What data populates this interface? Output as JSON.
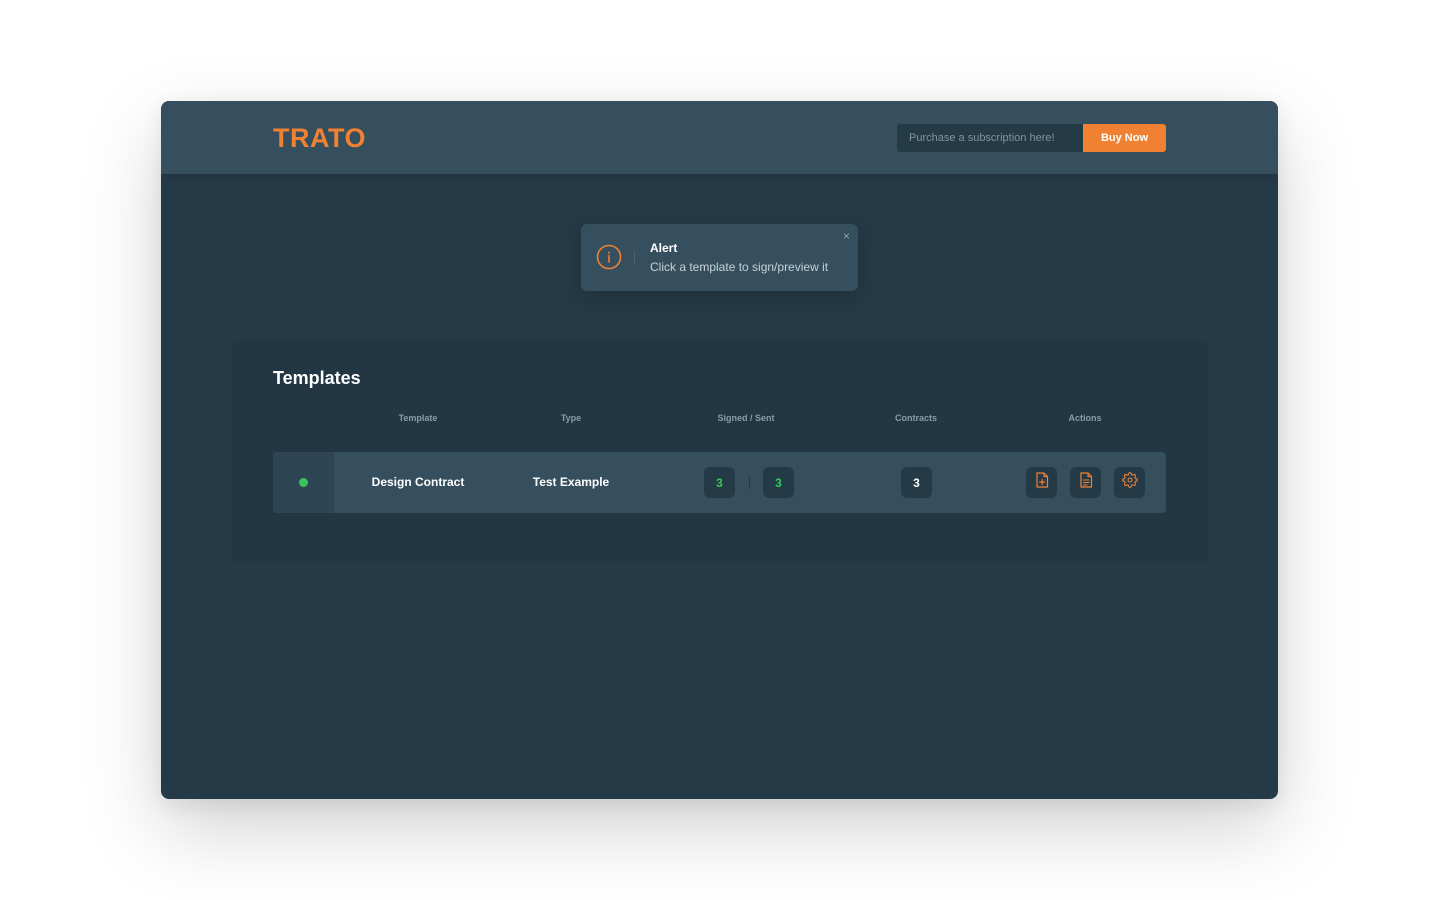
{
  "header": {
    "logo": "TRATO",
    "subscription_placeholder": "Purchase a subscription here!",
    "buy_label": "Buy Now"
  },
  "alert": {
    "title": "Alert",
    "message": "Click a template to sign/preview it",
    "close_glyph": "×",
    "icon": "info-icon"
  },
  "templates": {
    "title": "Templates",
    "columns": [
      "Template",
      "Type",
      "Signed / Sent",
      "Contracts",
      "Actions"
    ],
    "rows": [
      {
        "status": "active",
        "template": "Design Contract",
        "type": "Test Example",
        "signed": "3",
        "sent": "3",
        "contracts": "3",
        "actions": [
          "file-plus-icon",
          "file-text-icon",
          "gear-icon"
        ]
      }
    ]
  },
  "colors": {
    "brand": "#f08032",
    "status_active": "#35c65a",
    "count_green": "#33cc5c",
    "background": "#253a47",
    "header": "#354f5e"
  }
}
